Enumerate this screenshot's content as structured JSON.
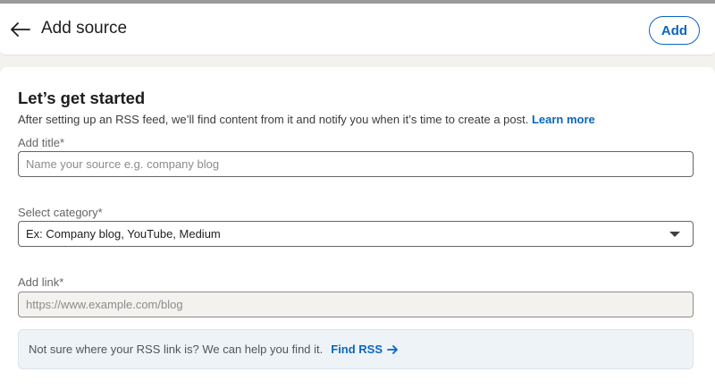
{
  "header": {
    "back_icon": "arrow-left-icon",
    "title": "Add source",
    "add_label": "Add"
  },
  "card": {
    "title": "Let’s get started",
    "description": "After setting up an RSS feed, we’ll find content from it and notify you when it’s time to create a post.",
    "learn_more": "Learn more"
  },
  "fields": {
    "title": {
      "label": "Add title*",
      "placeholder": "Name your source e.g. company blog",
      "value": ""
    },
    "category": {
      "label": "Select category*",
      "selected": "Ex: Company blog, YouTube, Medium",
      "caret_icon": "caret-down-icon"
    },
    "link": {
      "label": "Add link*",
      "placeholder": "https://www.example.com/blog",
      "value": ""
    }
  },
  "hint": {
    "text": "Not sure where your RSS link is? We can help you find it.",
    "action": "Find RSS",
    "action_icon": "arrow-right-icon"
  },
  "colors": {
    "accent": "#0a66c2",
    "page_background": "#f3f2ef",
    "hint_background": "#eef3f8"
  }
}
